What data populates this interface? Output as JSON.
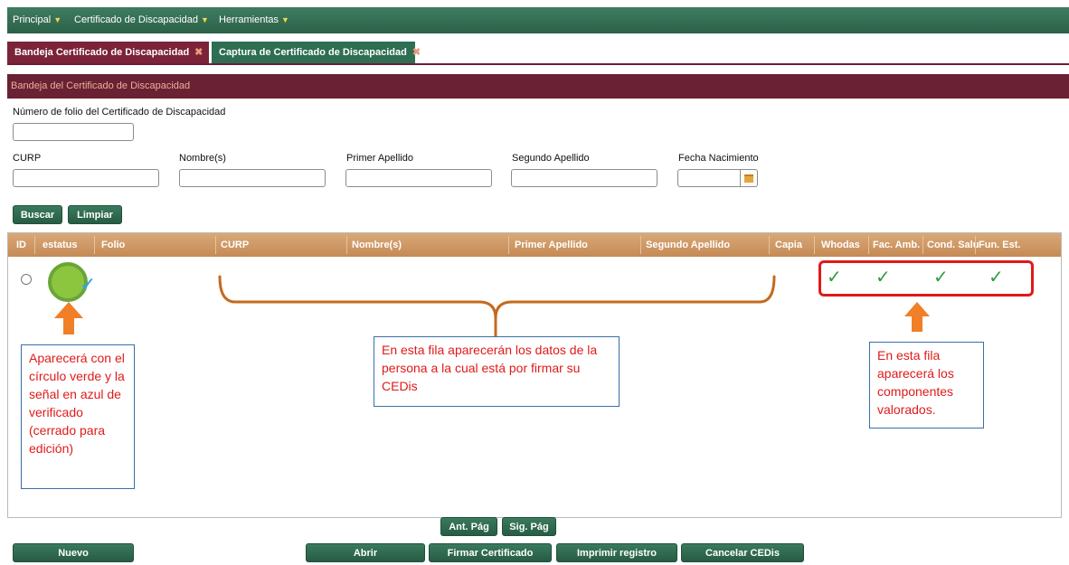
{
  "menu": {
    "items": [
      {
        "label": "Principal"
      },
      {
        "label": "Certificado de Discapacidad"
      },
      {
        "label": "Herramientas"
      }
    ]
  },
  "tabs": [
    {
      "label": "Bandeja Certificado de Discapacidad"
    },
    {
      "label": "Captura de Certificado de Discapacidad"
    }
  ],
  "section": {
    "title": "Bandeja del Certificado de Discapacidad"
  },
  "form": {
    "folio_label": "Número de folio del Certificado de Discapacidad",
    "curp_label": "CURP",
    "nombre_label": "Nombre(s)",
    "primer_apellido_label": "Primer Apellido",
    "segundo_apellido_label": "Segundo Apellido",
    "fecha_label": "Fecha Nacimiento",
    "buscar": "Buscar",
    "limpiar": "Limpiar"
  },
  "grid": {
    "columns": [
      "ID",
      "estatus",
      "Folio",
      "CURP",
      "Nombre(s)",
      "Primer Apellido",
      "Segundo Apellido",
      "Capia",
      "Whodas",
      "Fac. Amb.",
      "Cond. Salu",
      "Fun. Est."
    ],
    "row": {
      "status_color": "#8cc63f",
      "verify_color": "#36a3e8",
      "checks": [
        "✓",
        "✓",
        "✓",
        "✓"
      ]
    }
  },
  "annotations": {
    "left": "Aparecerá con el círculo verde y la señal en azul de verificado (cerrado para edición)",
    "middle": "En esta fila aparecerán los datos de la persona a la cual está por firmar su CEDis",
    "right": "En esta fila aparecerá los componentes valorados."
  },
  "pager": {
    "prev": "Ant. Pág",
    "next": "Sig. Pág"
  },
  "actions": {
    "nuevo": "Nuevo",
    "abrir": "Abrir",
    "firmar": "Firmar Certificado",
    "imprimir": "Imprimir registro",
    "cancelar": "Cancelar CEDis"
  },
  "colors": {
    "menu_green": "#2e6e52",
    "maroon": "#692133",
    "highlight_red": "#e0191b",
    "arrow_orange": "#f07f27",
    "bracket_brown": "#c46a1e"
  }
}
